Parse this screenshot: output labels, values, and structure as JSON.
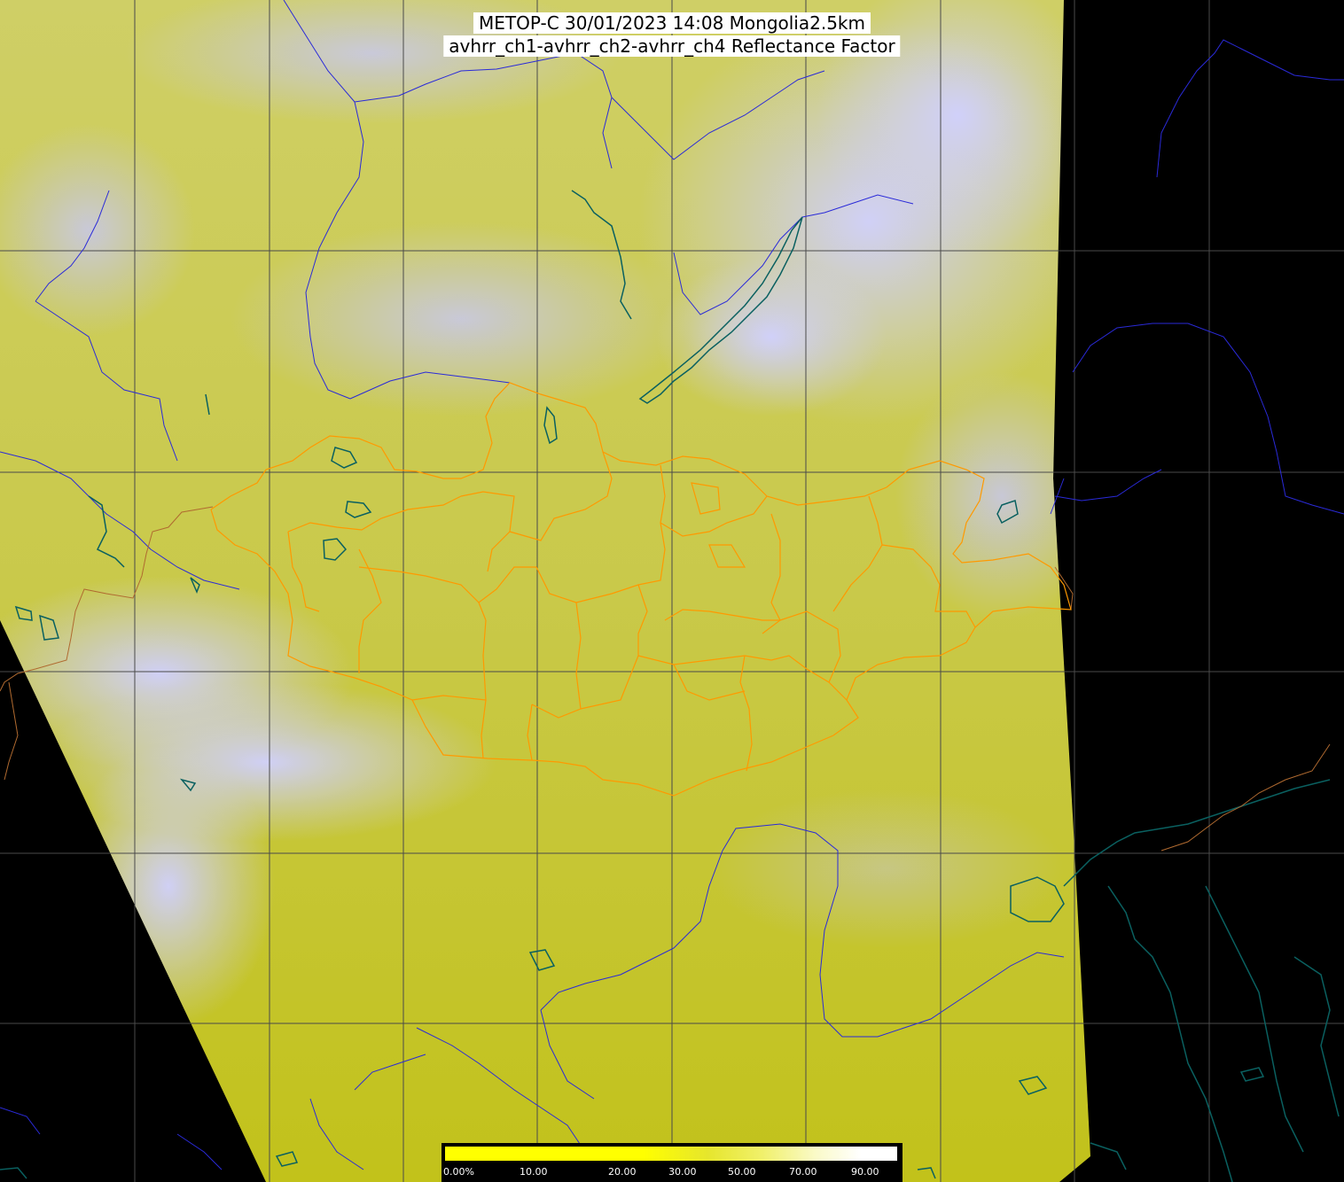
{
  "title": {
    "line1": "METOP-C 30/01/2023 14:08 Mongolia2.5km",
    "line2": "avhrr_ch1-avhrr_ch2-avhrr_ch4 Reflectance Factor"
  },
  "colorbar": {
    "ticks": [
      "0.00%",
      "10.00",
      "20.00",
      "30.00",
      "50.00",
      "70.00",
      "90.00"
    ],
    "colors": [
      "#ffff00",
      "#e6e62c",
      "#f0f06a",
      "#fafac8",
      "#ffffff"
    ]
  },
  "colors": {
    "background": "#000000",
    "swath_yellow": "#c7c733",
    "cloud_lavender": "#c8c8f0",
    "graticule": "#4a4a4a",
    "rivers": "#2a2ad8",
    "lakes": "#0a6060",
    "admin_borders": "#ff9900",
    "national_borders": "#b06a30"
  }
}
